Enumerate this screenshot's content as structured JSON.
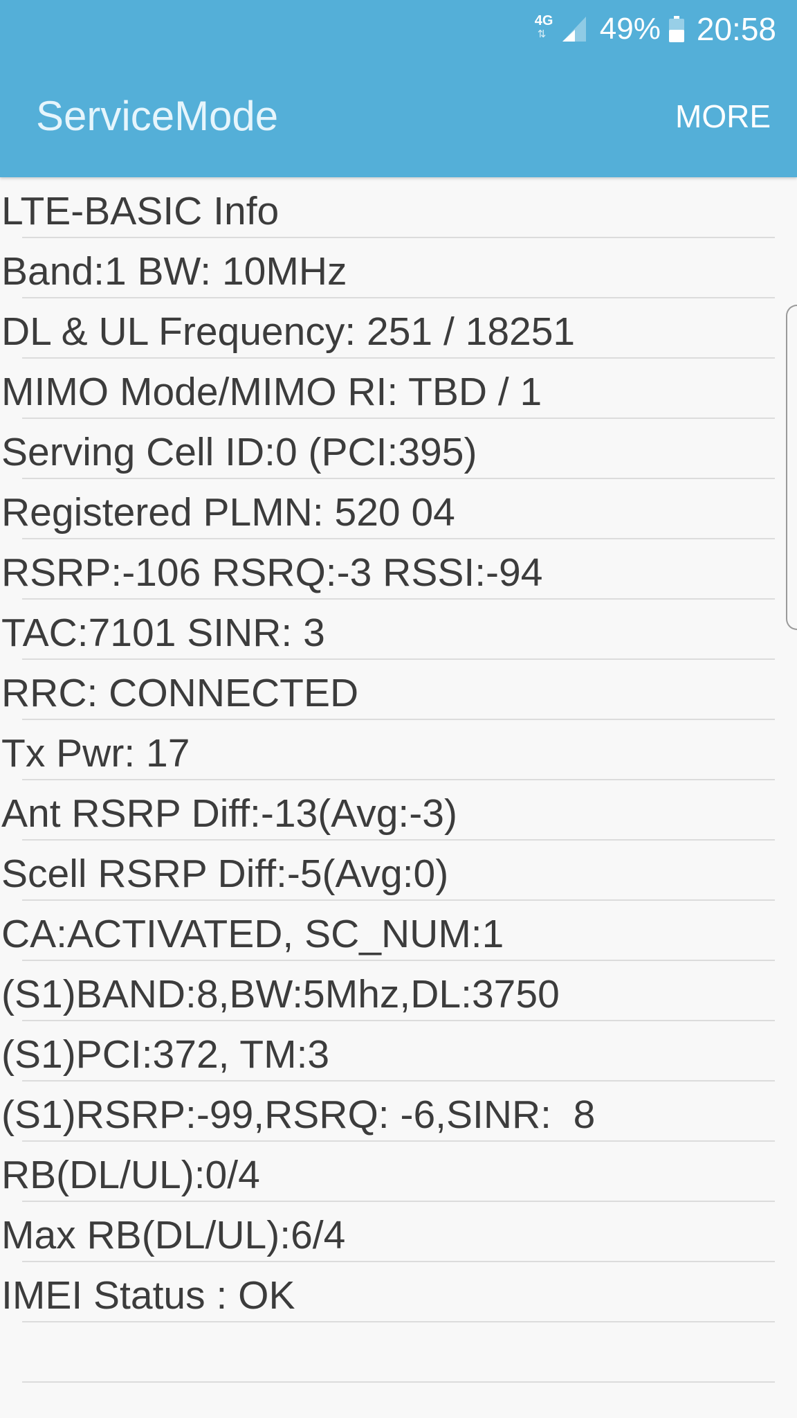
{
  "status_bar": {
    "network_type": "4G",
    "battery_percent": "49%",
    "time": "20:58"
  },
  "app_bar": {
    "title": "ServiceMode",
    "more_label": "MORE"
  },
  "info_rows": [
    "LTE-BASIC Info",
    "Band:1 BW: 10MHz",
    "DL & UL Frequency: 251 / 18251",
    "MIMO Mode/MIMO RI: TBD / 1",
    "Serving Cell ID:0 (PCI:395)",
    "Registered PLMN: 520 04",
    "RSRP:-106 RSRQ:-3 RSSI:-94",
    "TAC:7101 SINR: 3",
    "RRC: CONNECTED",
    "Tx Pwr: 17",
    "Ant RSRP Diff:-13(Avg:-3)",
    "Scell RSRP Diff:-5(Avg:0)",
    "CA:ACTIVATED, SC_NUM:1",
    "(S1)BAND:8,BW:5Mhz,DL:3750",
    "(S1)PCI:372, TM:3",
    "(S1)RSRP:-99,RSRQ: -6,SINR:  8",
    "RB(DL/UL):0/4",
    "Max RB(DL/UL):6/4",
    "IMEI Status : OK",
    ""
  ],
  "colors": {
    "app_bar": "#54afd8",
    "background": "#f8f8f8",
    "text": "#3c3c3c",
    "divider": "#dcdcdc"
  }
}
